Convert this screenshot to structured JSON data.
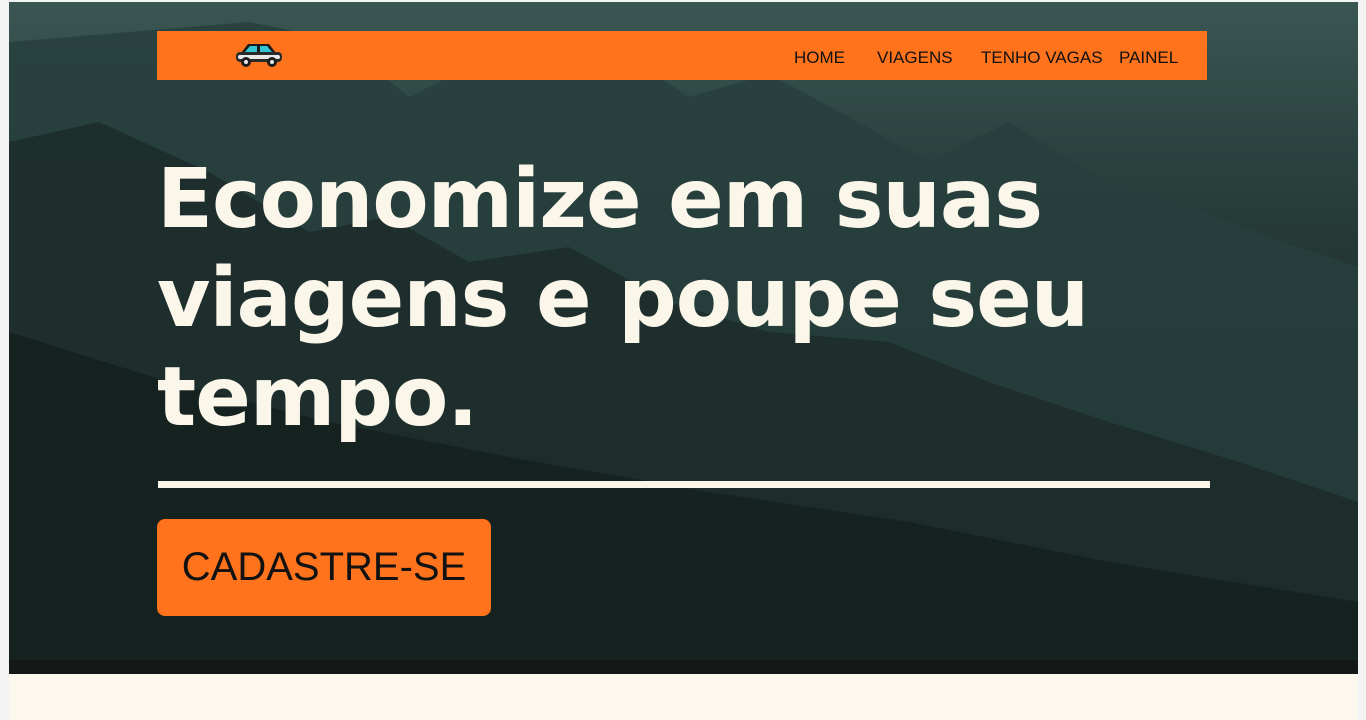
{
  "navbar": {
    "logo_icon": "car-icon",
    "links": [
      "HOME",
      "VIAGENS",
      "TENHO VAGAS",
      "PAINEL"
    ]
  },
  "hero": {
    "headline_lines": [
      "Economize em suas",
      "viagens e poupe seu",
      "tempo."
    ],
    "cta_label": "CADASTRE-SE"
  },
  "colors": {
    "accent": "#ff731c",
    "hero_text": "#fbf6ea",
    "hero_bg": "#1f302e",
    "page_bg": "#fdf8ee"
  }
}
